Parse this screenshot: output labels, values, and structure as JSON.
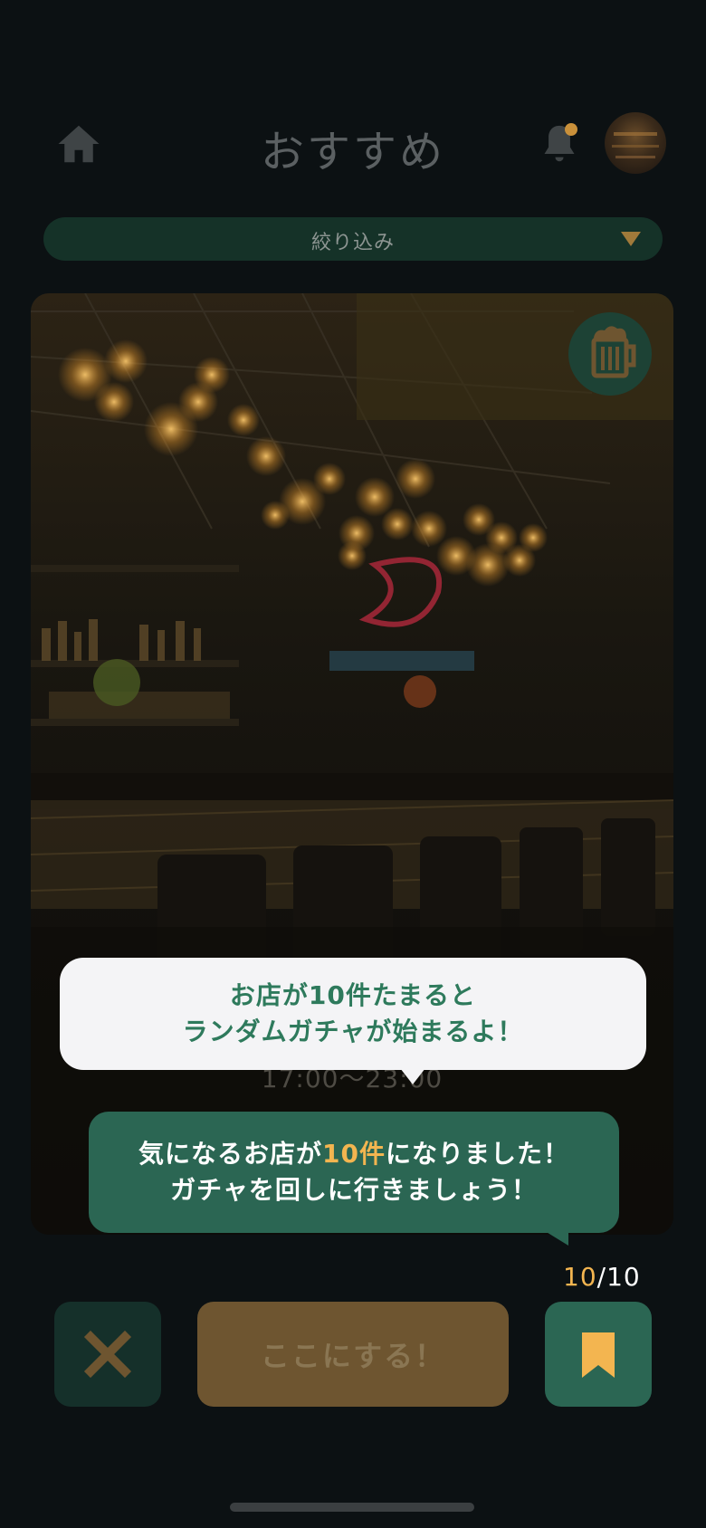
{
  "header": {
    "title": "おすすめ",
    "home_icon": "home-icon",
    "bell_icon": "bell-icon",
    "avatar_icon": "avatar"
  },
  "filter": {
    "label": "絞り込み",
    "icon": "caret-down-icon"
  },
  "card": {
    "beer_icon": "beer-mug-icon",
    "hours": "17:00〜23:00"
  },
  "tooltip_white": {
    "line1": "お店が10件たまると",
    "line2": "ランダムガチャが始まるよ！"
  },
  "tooltip_green": {
    "line1_before": "気になるお店が",
    "line1_accent": "10件",
    "line1_after": "になりました！",
    "line2": "ガチャを回しに行きましょう！"
  },
  "counter": {
    "current": "10",
    "separator": "/",
    "total": "10"
  },
  "actions": {
    "skip_icon": "close-icon",
    "decide_label": "ここにする！",
    "bookmark_icon": "bookmark-icon"
  },
  "colors": {
    "background": "#0c1113",
    "accent_orange": "#f3b550",
    "green_primary": "#2b6653",
    "green_dark": "#153228"
  }
}
